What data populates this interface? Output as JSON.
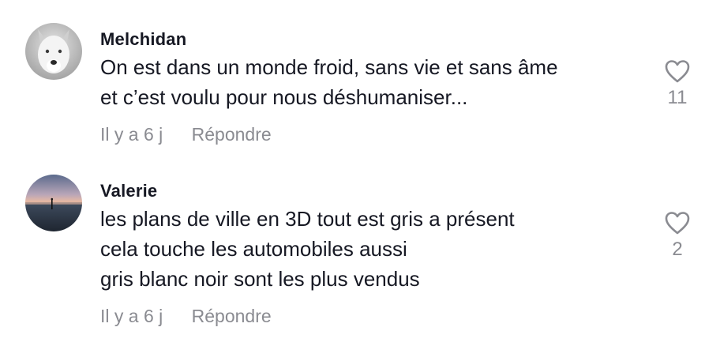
{
  "comments": [
    {
      "username": "Melchidan",
      "avatar": "wolf-avatar",
      "text": "On est dans un monde froid, sans vie et sans âme\net c’est voulu pour nous déshumaniser...",
      "time": "Il y a 6 j",
      "reply_label": "Répondre",
      "likes": "11"
    },
    {
      "username": "Valerie",
      "avatar": "sunset-beach-avatar",
      "text": "les plans de ville en 3D tout est gris a présent\ncela touche les automobiles aussi\ngris blanc noir sont les plus vendus",
      "time": "Il y a 6 j",
      "reply_label": "Répondre",
      "likes": "2"
    }
  ],
  "colors": {
    "text": "#161823",
    "muted": "#8a8b91"
  },
  "icons": {
    "like": "heart-outline-icon"
  }
}
